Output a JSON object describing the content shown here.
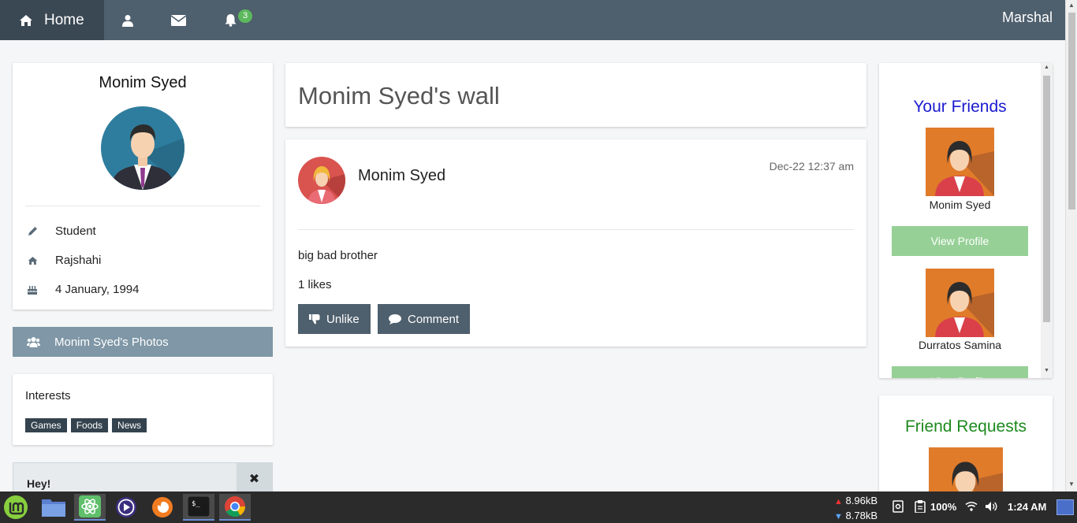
{
  "nav": {
    "home_label": "Home",
    "notification_count": "3",
    "user_name": "Marshal"
  },
  "profile": {
    "name": "Monim Syed",
    "occupation": "Student",
    "location": "Rajshahi",
    "birthday": "4 January, 1994",
    "photos_label": "Monim Syed's Photos"
  },
  "interests": {
    "title": "Interests",
    "tags": [
      "Games",
      "Foods",
      "News"
    ]
  },
  "alert": {
    "title": "Hey!",
    "close_glyph": "✖"
  },
  "wall": {
    "title": "Monim Syed's wall"
  },
  "post": {
    "author": "Monim Syed",
    "timestamp": "Dec-22 12:37 am",
    "text": "big bad brother",
    "likes": "1 likes",
    "unlike_label": "Unlike",
    "comment_label": "Comment"
  },
  "friends": {
    "title": "Your Friends",
    "items": [
      {
        "name": "Monim Syed",
        "button": "View Profile"
      },
      {
        "name": "Durratos Samina",
        "button": "View Profile"
      }
    ]
  },
  "requests": {
    "title": "Friend Requests"
  },
  "taskbar": {
    "upload_speed": "8.96kB",
    "download_speed": "8.78kB",
    "battery": "100%",
    "clock": "1:24 AM"
  },
  "colors": {
    "navbar": "#4e5f6d",
    "friends_title": "#1a1ad0",
    "requests_title": "#1e8a1e",
    "view_profile_button": "#96d096",
    "badge": "#5cb85c"
  }
}
